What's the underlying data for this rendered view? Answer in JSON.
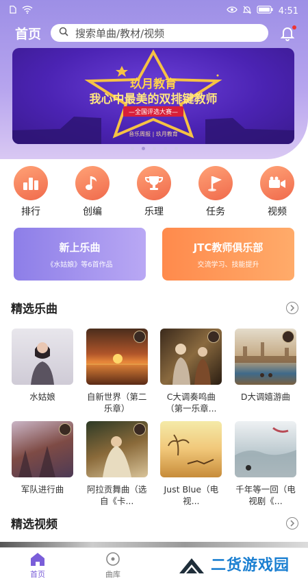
{
  "statusbar": {
    "time": "4:51"
  },
  "header": {
    "title": "首页",
    "search_placeholder": "搜索单曲/教材/视频"
  },
  "banner": {
    "brand": "玖月教育",
    "title": "我心中最美的双排键教师",
    "subtitle": "—全国评选大赛—",
    "footer": "音乐周报 | 玖月教育",
    "dots": 5,
    "active_dot": 1
  },
  "categories": [
    {
      "label": "排行",
      "icon": "rank-icon"
    },
    {
      "label": "创编",
      "icon": "music-note-icon"
    },
    {
      "label": "乐理",
      "icon": "trophy-icon"
    },
    {
      "label": "任务",
      "icon": "flag-icon"
    },
    {
      "label": "视频",
      "icon": "video-icon"
    }
  ],
  "promos": [
    {
      "title": "新上乐曲",
      "subtitle": "《水姑娘》等6首作品"
    },
    {
      "title": "JTC教师俱乐部",
      "subtitle": "交流学习、技能提升"
    }
  ],
  "featured_songs": {
    "title": "精选乐曲",
    "rows": [
      [
        {
          "title": "水姑娘"
        },
        {
          "title": "自新世界（第二乐章）"
        },
        {
          "title": "C大调奏鸣曲（第一乐章..."
        },
        {
          "title": "D大调嬉游曲"
        }
      ],
      [
        {
          "title": "军队进行曲"
        },
        {
          "title": "阿拉贡舞曲（选自《卡..."
        },
        {
          "title": "Just Blue（电视..."
        },
        {
          "title": "千年等一回（电视剧《..."
        }
      ]
    ]
  },
  "featured_videos": {
    "title": "精选视频"
  },
  "tabbar": [
    {
      "label": "首页",
      "active": true
    },
    {
      "label": "曲库",
      "active": false
    }
  ],
  "watermark": {
    "text": "二货游戏园"
  },
  "colors": {
    "accent": "#7a5ed9",
    "orange": "#f06a4c",
    "header_purple": "#9d8fe6"
  }
}
